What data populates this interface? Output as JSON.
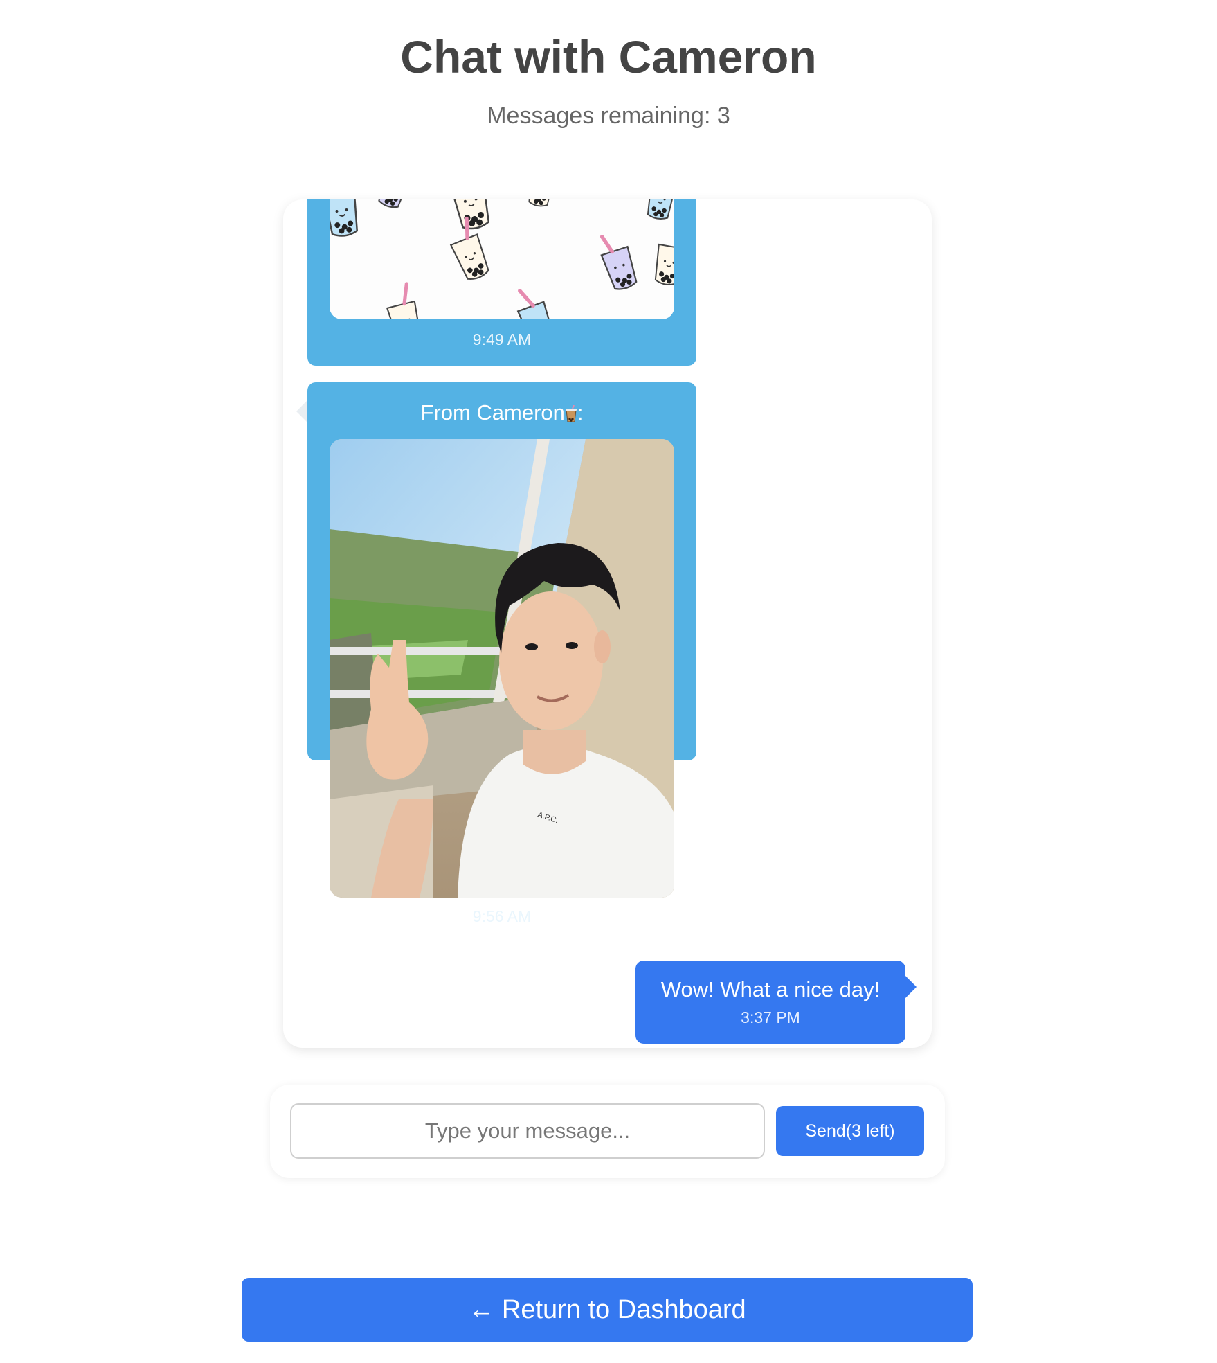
{
  "header": {
    "title": "Chat with Cameron",
    "messages_remaining": "Messages remaining: 3"
  },
  "messages": [
    {
      "type": "received",
      "content": "image",
      "image_subject": "bubble-tea-pattern",
      "time": "9:49 AM"
    },
    {
      "type": "received",
      "sender": "From Cameron",
      "sender_suffix": ":",
      "sender_icon": "bubble-tea-icon",
      "content": "image",
      "image_subject": "selfie-peace-sign-by-window",
      "time": "9:56 AM"
    },
    {
      "type": "sent",
      "text": "Wow! What a nice day!",
      "time": "3:37 PM"
    }
  ],
  "composer": {
    "placeholder": "Type your message...",
    "send_label": "Send(3 left)"
  },
  "footer": {
    "return_label": "← Return to Dashboard"
  },
  "colors": {
    "received_bubble": "#54b2e4",
    "sent_bubble": "#3578f0",
    "button": "#3578f0"
  }
}
